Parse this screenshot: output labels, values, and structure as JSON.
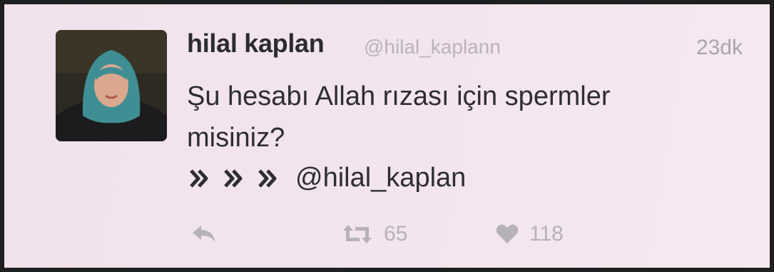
{
  "tweet": {
    "display_name": "hilal kaplan",
    "handle": "@hilal_kaplann",
    "timestamp": "23dk",
    "text_lines": [
      "Şu hesabı Allah rızası için spermler",
      "misiniz?"
    ],
    "mention": "@hilal_kaplan",
    "retweet_count": "65",
    "like_count": "118"
  },
  "icons": {
    "avatar": "profile-photo",
    "quote_arrows": [
      "chevron-right-icon",
      "chevron-right-icon",
      "chevron-right-icon"
    ],
    "reply": "reply-icon",
    "retweet": "retweet-icon",
    "like": "heart-icon"
  },
  "colors": {
    "background": "#f3e4ee",
    "text": "#2e2e32",
    "muted": "#b7b2b7"
  }
}
